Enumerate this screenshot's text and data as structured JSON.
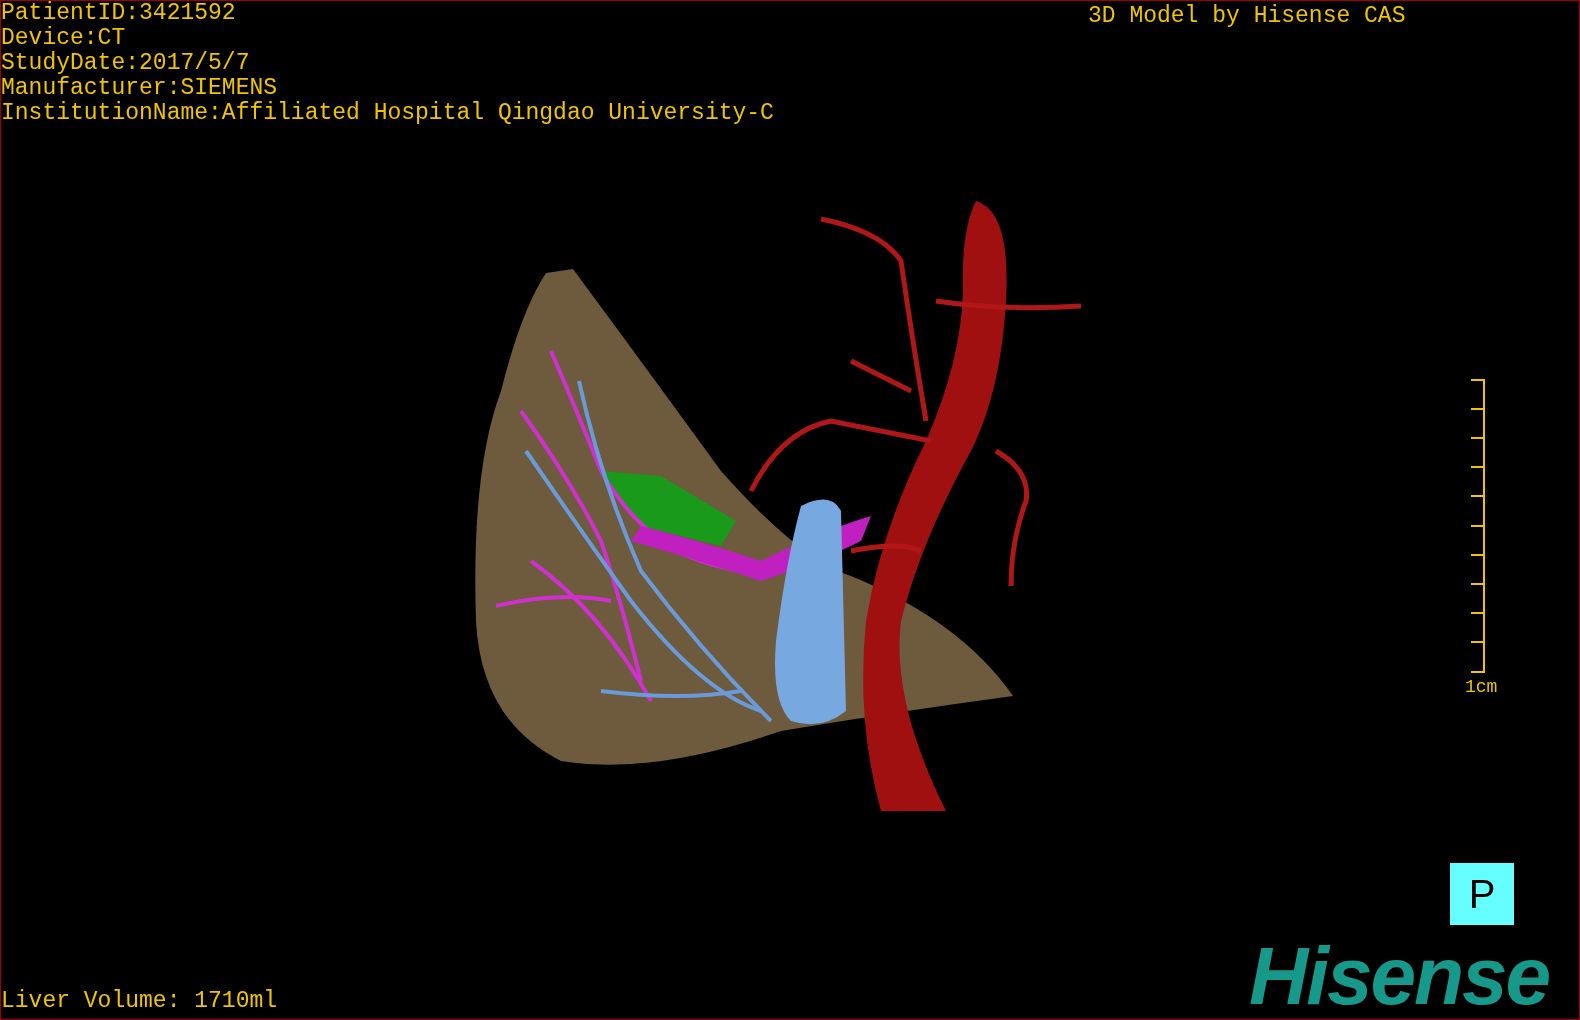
{
  "info_lines": [
    "PatientID:3421592",
    "Device:CT",
    "StudyDate:2017/5/7",
    "Manufacturer:SIEMENS",
    "InstitutionName:Affiliated Hospital Qingdao University-C"
  ],
  "title": "3D Model by Hisense CAS",
  "scale": {
    "label": "1cm"
  },
  "orientation_marker": "P",
  "volume": "Liver Volume: 1710ml",
  "logo": "Hisense"
}
